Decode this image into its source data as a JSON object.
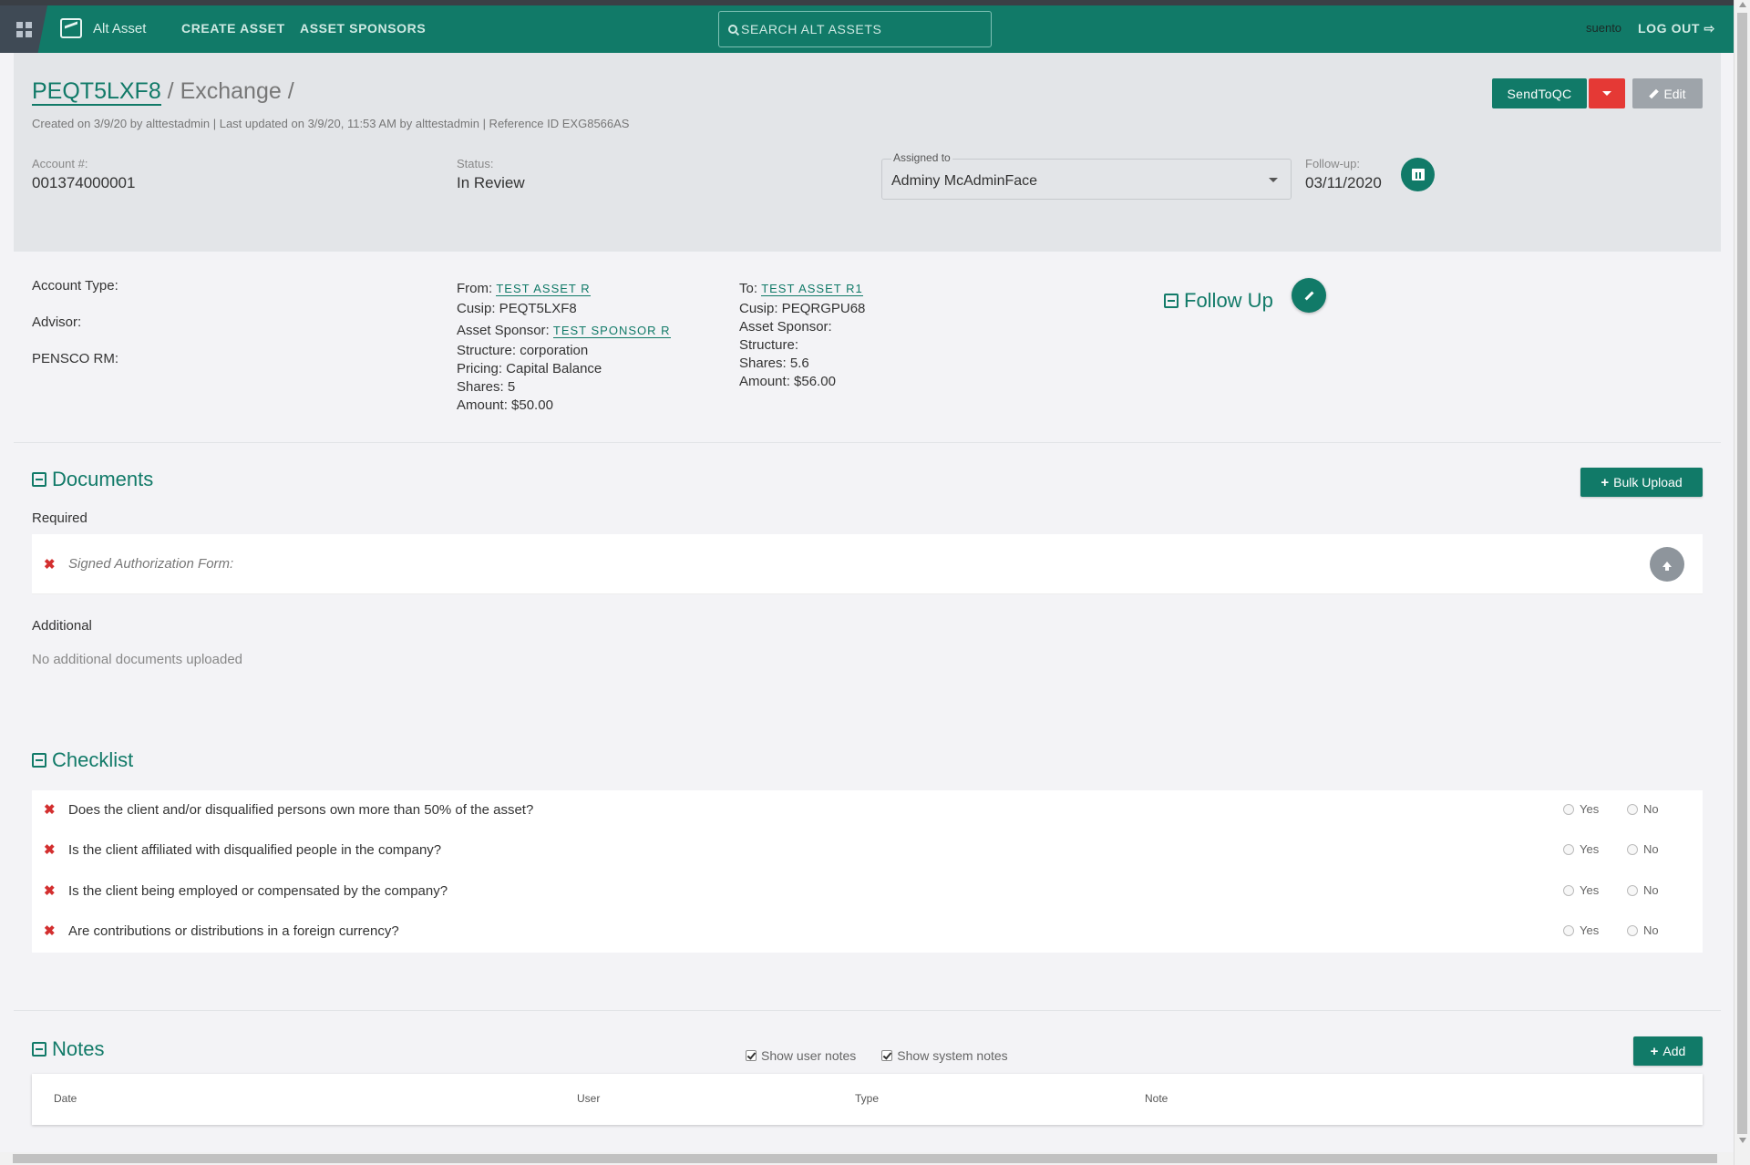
{
  "nav": {
    "brand": "Alt Asset",
    "links": [
      "CREATE ASSET",
      "ASSET SPONSORS"
    ],
    "search_placeholder": "SEARCH ALT ASSETS",
    "username": "suento",
    "logout": "LOG OUT"
  },
  "header": {
    "asset_id": "PEQT5LXF8",
    "title_rest": " / Exchange /",
    "meta": "Created on 3/9/20 by alttestadmin | Last updated on 3/9/20, 11:53 AM by alttestadmin | Reference ID EXG8566AS",
    "send_label": "SendToQC",
    "edit_label": "Edit",
    "account_label": "Account #:",
    "account_value": "001374000001",
    "status_label": "Status:",
    "status_value": "In Review",
    "assigned_label": "Assigned to",
    "assigned_value": "Adminy McAdminFace",
    "followup_label": "Follow-up:",
    "followup_value": "03/11/2020"
  },
  "details": {
    "account_type_label": "Account Type:",
    "advisor_label": "Advisor:",
    "rm_label": "PENSCO RM:",
    "from": {
      "prefix": "From:",
      "asset": "TEST ASSET R",
      "cusip": "Cusip: PEQT5LXF8",
      "sponsor_prefix": "Asset Sponsor:",
      "sponsor": "TEST SPONSOR R",
      "structure": "Structure: corporation",
      "pricing": "Pricing: Capital Balance",
      "shares": "Shares: 5",
      "amount": "Amount: $50.00"
    },
    "to": {
      "prefix": "To:",
      "asset": "TEST ASSET R1",
      "cusip": "Cusip: PEQRGPU68",
      "sponsor": "Asset Sponsor:",
      "structure": "Structure:",
      "shares": "Shares: 5.6",
      "amount": "Amount: $56.00"
    },
    "follow_up_title": "Follow Up"
  },
  "documents": {
    "title": "Documents",
    "bulk_upload": "Bulk Upload",
    "required_label": "Required",
    "required_items": [
      "Signed Authorization Form:"
    ],
    "additional_label": "Additional",
    "additional_empty": "No additional documents uploaded"
  },
  "checklist": {
    "title": "Checklist",
    "yes": "Yes",
    "no": "No",
    "items": [
      "Does the client and/or disqualified persons own more than 50% of the asset?",
      "Is the client affiliated with disqualified people in the company?",
      "Is the client being employed or compensated by the company?",
      "Are contributions or distributions in a foreign currency?"
    ]
  },
  "notes": {
    "title": "Notes",
    "show_user": "Show user notes",
    "show_system": "Show system notes",
    "add_label": "Add",
    "columns": [
      "Date",
      "User",
      "Type",
      "Note"
    ]
  },
  "colors": {
    "primary": "#117a68",
    "danger": "#e53935",
    "header_bg": "#e3e5e8"
  }
}
